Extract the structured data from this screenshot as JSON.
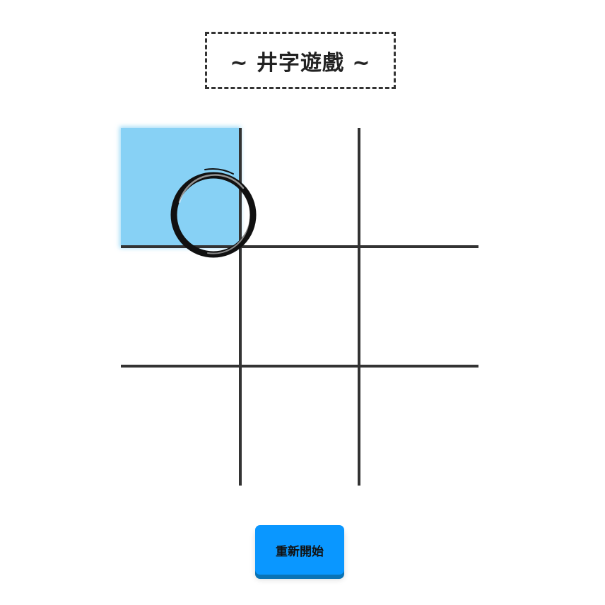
{
  "title": "~ 井字遊戲 ~",
  "board": {
    "cells": [
      {
        "row": 0,
        "col": 0,
        "mark": "O",
        "highlighted": true
      },
      {
        "row": 0,
        "col": 1,
        "mark": "",
        "highlighted": false
      },
      {
        "row": 0,
        "col": 2,
        "mark": "",
        "highlighted": false
      },
      {
        "row": 1,
        "col": 0,
        "mark": "",
        "highlighted": false
      },
      {
        "row": 1,
        "col": 1,
        "mark": "",
        "highlighted": false
      },
      {
        "row": 1,
        "col": 2,
        "mark": "",
        "highlighted": false
      },
      {
        "row": 2,
        "col": 0,
        "mark": "",
        "highlighted": false
      },
      {
        "row": 2,
        "col": 1,
        "mark": "",
        "highlighted": false
      },
      {
        "row": 2,
        "col": 2,
        "mark": "",
        "highlighted": false
      }
    ]
  },
  "colors": {
    "highlight": "#87d1f5",
    "grid": "#333333",
    "button": "#0a97ff",
    "button_shadow": "#0a73b5",
    "mark": "#111111"
  },
  "icons": {
    "o_mark": "brush-circle-icon"
  },
  "restart_button": {
    "label": "重新開始"
  }
}
